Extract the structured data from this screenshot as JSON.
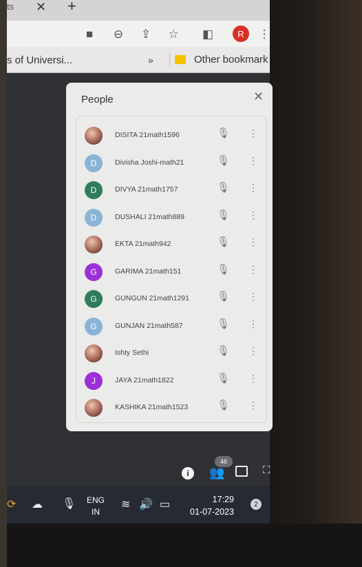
{
  "browser": {
    "tab_title": "ts",
    "tab_close": "✕",
    "new_tab": "+",
    "profile_initial": "R",
    "toolbar_icons": [
      "camera-icon",
      "zoom-out-icon",
      "share-icon",
      "star-icon",
      "sidebar-icon",
      "kebab-icon"
    ],
    "bookmarks": {
      "first": "s of Universi...",
      "overflow": "»",
      "other": "Other bookmark"
    }
  },
  "people_panel": {
    "title": "People",
    "close": "✕",
    "participants": [
      {
        "name": "DISITA 21math1596",
        "initial": "",
        "color": "#c0392b",
        "photo": true
      },
      {
        "name": "Divisha Joshi-math21",
        "initial": "D",
        "color": "#8ab4d6",
        "photo": false
      },
      {
        "name": "DIVYA 21math1757",
        "initial": "D",
        "color": "#2e7d5b",
        "photo": false
      },
      {
        "name": "DUSHALI 21math889",
        "initial": "D",
        "color": "#8ab4d6",
        "photo": false
      },
      {
        "name": "EKTA 21math942",
        "initial": "",
        "color": "#5a4a40",
        "photo": true
      },
      {
        "name": "GARIMA 21math151",
        "initial": "G",
        "color": "#9b30d9",
        "photo": false
      },
      {
        "name": "GUNGUN 21math1291",
        "initial": "G",
        "color": "#2e7d5b",
        "photo": false
      },
      {
        "name": "GUNJAN 21math587",
        "initial": "G",
        "color": "#8ab4d6",
        "photo": false
      },
      {
        "name": "Ishty Sethi",
        "initial": "",
        "color": "#c98f80",
        "photo": true
      },
      {
        "name": "JAYA 21math1822",
        "initial": "J",
        "color": "#9b30d9",
        "photo": false
      },
      {
        "name": "KASHIKA 21math1523",
        "initial": "",
        "color": "#4a78c0",
        "photo": true
      }
    ]
  },
  "meet_controls": {
    "people_count": "46",
    "info_glyph": "i"
  },
  "taskbar": {
    "lang_top": "ENG",
    "lang_bottom": "IN",
    "time": "17:29",
    "date": "01-07-2023",
    "notifications": "2"
  }
}
